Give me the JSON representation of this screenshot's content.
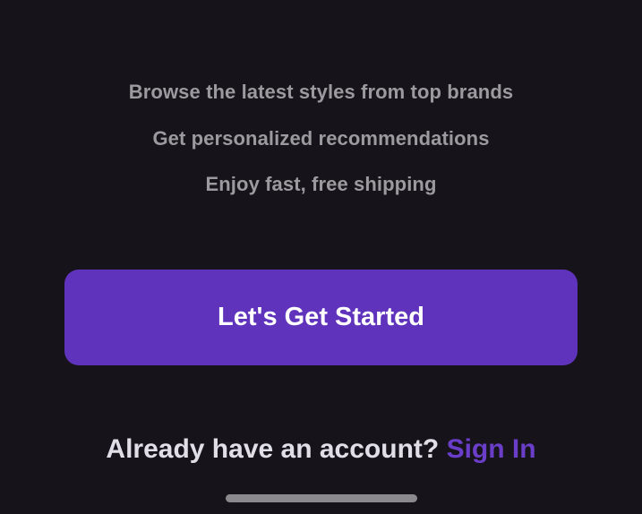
{
  "features": [
    "Browse the latest styles from top brands",
    "Get personalized recommendations",
    "Enjoy fast, free shipping"
  ],
  "cta": {
    "label": "Let's Get Started"
  },
  "signin": {
    "prompt": "Already have an account?",
    "link": "Sign In"
  },
  "colors": {
    "background": "#16131a",
    "accent": "#6033bd",
    "link": "#6a3ec8",
    "feature_text": "#9b9a9e"
  }
}
